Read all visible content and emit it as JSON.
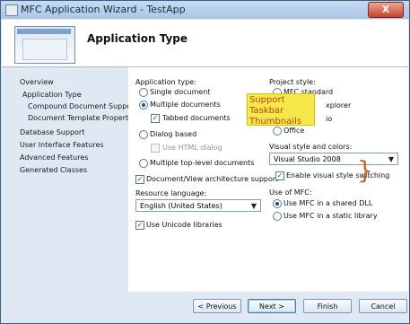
{
  "window": {
    "title": "MFC Application Wizard - TestApp",
    "close_label": "X"
  },
  "header": {
    "title": "Application Type"
  },
  "nav": [
    "Overview",
    "Application Type",
    "Compound Document Support",
    "Document Template Properties",
    "Database Support",
    "User Interface Features",
    "Advanced Features",
    "Generated Classes"
  ],
  "app_type": {
    "heading": "Application type:",
    "single": "Single document",
    "multiple": "Multiple documents",
    "tabbed": "Tabbed documents",
    "dialog": "Dialog based",
    "use_html": "Use HTML dialog",
    "multi_top": "Multiple top-level documents",
    "doc_view": "Document/View architecture support"
  },
  "resource_language": {
    "heading": "Resource language:",
    "value": "English (United States)"
  },
  "unicode": "Use Unicode libraries",
  "callout": "Support Taskbar Thumbnails",
  "project_style": {
    "heading": "Project style:",
    "mfc_standard": "MFC standard",
    "explorer": "xplorer",
    "visual_studio": "io",
    "office": "Office"
  },
  "visual_style": {
    "heading": "Visual style and colors:",
    "value": "Visual Studio 2008",
    "enable": "Enable visual style switching"
  },
  "use_of_mfc": {
    "heading": "Use of MFC:",
    "shared": "Use MFC in a shared DLL",
    "static": "Use MFC in a static library"
  },
  "buttons": {
    "previous": "< Previous",
    "next": "Next >",
    "finish": "Finish",
    "cancel": "Cancel"
  }
}
